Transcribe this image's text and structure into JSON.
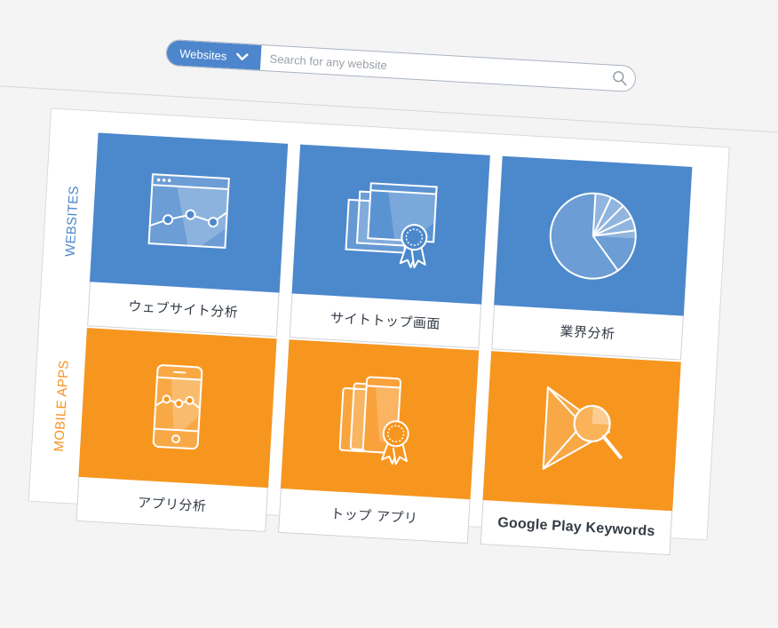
{
  "search": {
    "category_label": "Websites",
    "placeholder": "Search for any website",
    "value": ""
  },
  "sections": {
    "websites_label": "WEBSITES",
    "apps_label": "MOBILE APPS"
  },
  "cards": [
    {
      "label": "ウェブサイト分析",
      "icon": "website-analytics-icon",
      "color": "#4c88cc"
    },
    {
      "label": "サイトトップ画面",
      "icon": "top-sites-award-icon",
      "color": "#4c88cc"
    },
    {
      "label": "業界分析",
      "icon": "pie-chart-icon",
      "color": "#4c88cc"
    },
    {
      "label": "アプリ分析",
      "icon": "app-analytics-icon",
      "color": "#f7961e"
    },
    {
      "label": "トップ アプリ",
      "icon": "top-apps-award-icon",
      "color": "#f7961e"
    },
    {
      "label": "Google Play Keywords",
      "icon": "play-keyword-search-icon",
      "color": "#f7961e"
    }
  ],
  "colors": {
    "accent_blue": "#4d86cc",
    "accent_orange": "#f7921e",
    "card_blue": "#4c88cc",
    "card_orange": "#f7961e"
  }
}
